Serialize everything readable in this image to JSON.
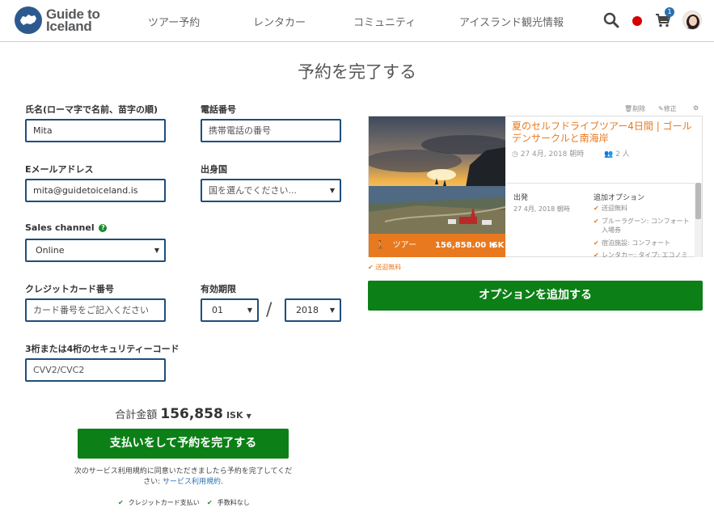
{
  "header": {
    "logo_line1": "Guide to",
    "logo_line2": "Iceland",
    "nav": [
      "ツアー予約",
      "レンタカー",
      "コミュニティ",
      "アイスランド観光情報"
    ],
    "cart_count": "1"
  },
  "page_title": "予約を完了する",
  "form": {
    "name_label": "氏名(ローマ字で名前、苗字の順)",
    "name_value": "Mita",
    "phone_label": "電話番号",
    "phone_placeholder": "携帯電話の番号",
    "email_label": "Eメールアドレス",
    "email_value": "mita@guidetoiceland.is",
    "country_label": "出身国",
    "country_value": "国を選んでください...",
    "sales_channel_label": "Sales channel",
    "sales_channel_value": "Online",
    "card_label": "クレジットカード番号",
    "card_placeholder": "カード番号をご記入ください",
    "expiry_label": "有効期限",
    "expiry_month": "01",
    "expiry_sep": "/",
    "expiry_year": "2018",
    "cvv_label": "3桁または4桁のセキュリティーコード",
    "cvv_placeholder": "CVV2/CVC2"
  },
  "total": {
    "label": "合計金額",
    "amount": "156,858",
    "currency": "ISK"
  },
  "complete_button": "支払いをして予約を完了する",
  "terms": {
    "text": "次のサービス利用規約に同意いただきましたら予約を完了してください:",
    "link": "サービス利用規約",
    "period": "."
  },
  "trust": [
    "クレジットカード支払い",
    "手数料なし"
  ],
  "cart": {
    "delete": "削除",
    "edit": "修正",
    "title": "夏のセルフドライブツアー4日間 | ゴールデンサークルと南海岸",
    "date": "27 4月, 2018 朝時",
    "people": "2 人",
    "departure_label": "出発",
    "departure_value": "27 4月, 2018 朝時",
    "options_label": "追加オプション",
    "options": [
      "送迎無料",
      "ブルーラグーン: コンフォート入場券",
      "宿泊施設: コンフォート",
      "レンタカー: タイプ: エコノミー"
    ],
    "price_type": "ツアー",
    "price": "156,858.00 ISK"
  },
  "free_shipping": "送迎無料",
  "add_options_button": "オプションを追加する",
  "colors": {
    "primary_green": "#0c8016",
    "accent_orange": "#e8791f",
    "input_border": "#1f4e79",
    "brand_blue": "#2c5a8f"
  }
}
